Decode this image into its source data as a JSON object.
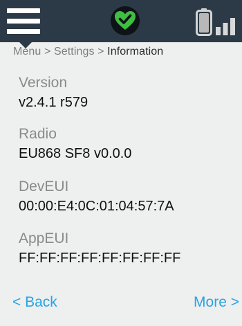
{
  "header": {
    "icons": {
      "menu": "menu-icon",
      "status": "heart-check-icon",
      "battery": "battery-icon",
      "signal": "signal-icon"
    },
    "colors": {
      "bar_background": "#2b3a46",
      "status_ok": "#3fbf3f"
    }
  },
  "breadcrumb": {
    "items": [
      "Menu",
      "Settings",
      "Information"
    ],
    "separator": ">"
  },
  "info": {
    "version": {
      "label": "Version",
      "value": "v2.4.1 r579"
    },
    "radio": {
      "label": "Radio",
      "value": "EU868 SF8 v0.0.0"
    },
    "deveui": {
      "label": "DevEUI",
      "value": "00:00:E4:0C:01:04:57:7A"
    },
    "appeui": {
      "label": "AppEUI",
      "value": "FF:FF:FF:FF:FF:FF:FF:FF"
    }
  },
  "nav": {
    "back_label": "< Back",
    "more_label": "More >",
    "link_color": "#2aa3e0"
  }
}
